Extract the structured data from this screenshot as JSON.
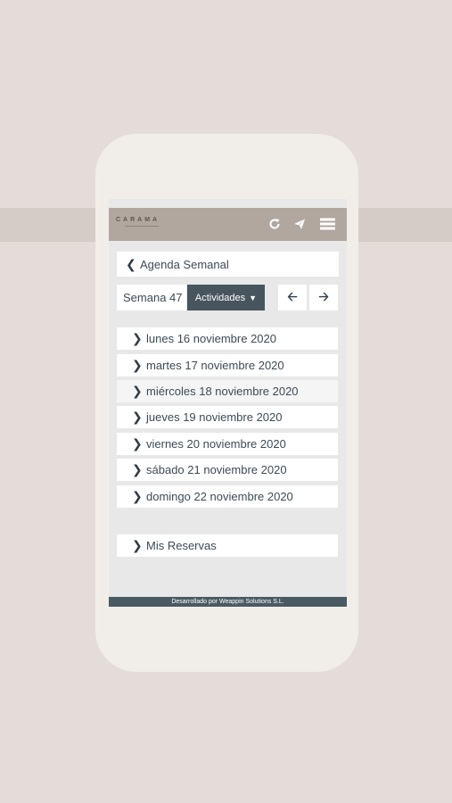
{
  "app": {
    "logo": "CARAMA",
    "icons": [
      "refresh-icon",
      "send-icon",
      "menu-icon"
    ]
  },
  "agenda": {
    "title": "Agenda Semanal",
    "week_label": "Semana 47",
    "activities_label": "Actividades"
  },
  "days": [
    {
      "label": "lunes 16 noviembre 2020"
    },
    {
      "label": "martes 17 noviembre 2020"
    },
    {
      "label": "miércoles 18 noviembre 2020"
    },
    {
      "label": "jueves 19 noviembre 2020"
    },
    {
      "label": "viernes 20 noviembre 2020"
    },
    {
      "label": "sábado 21 noviembre 2020"
    },
    {
      "label": "domingo 22 noviembre 2020"
    }
  ],
  "reservations": {
    "label": "Mis Reservas"
  },
  "footer": {
    "text": "Desarrollado por Weappin Solutions S.L."
  }
}
